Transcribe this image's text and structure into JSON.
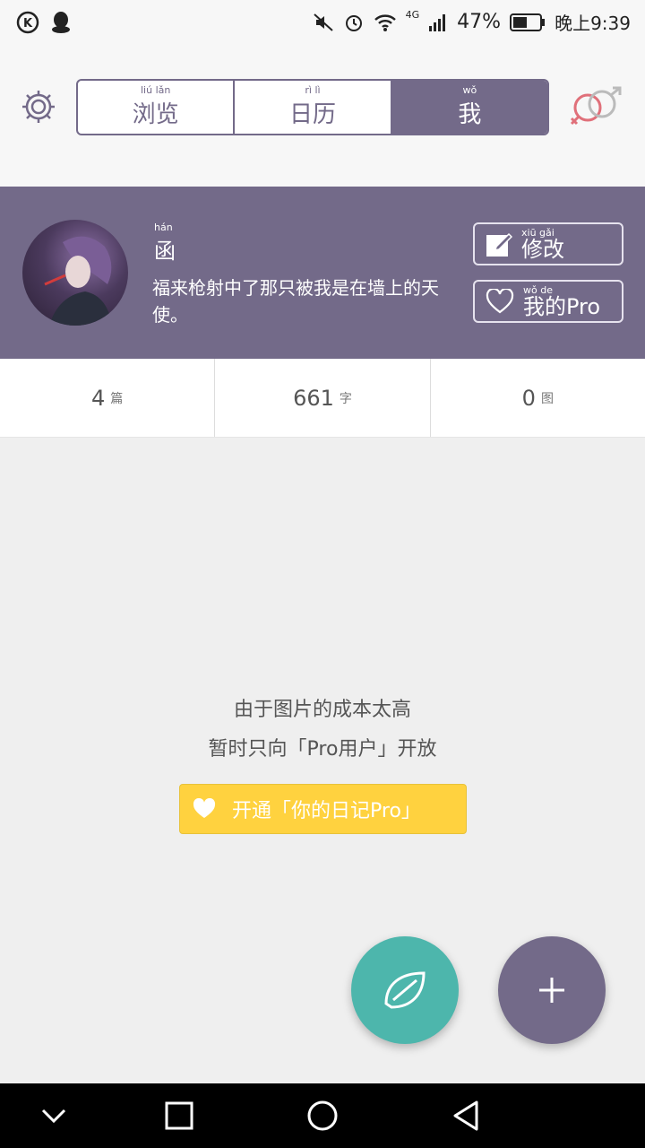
{
  "status_bar": {
    "battery": "47%",
    "network": "4G",
    "time": "晚上9:39"
  },
  "tabs": [
    {
      "label": "浏览",
      "pinyin": "liú lǎn"
    },
    {
      "label": "日历",
      "pinyin": "rì lì"
    },
    {
      "label": "我",
      "pinyin": "wǒ",
      "active": true
    }
  ],
  "profile": {
    "name": "函",
    "name_pinyin": "hán",
    "bio": "福来枪射中了那只被我是在墙上的天使。",
    "edit_label": "修改",
    "edit_pinyin": "xiū gǎi",
    "pro_label": "我的Pro",
    "pro_pinyin": "wǒ de"
  },
  "stats": [
    {
      "value": "4",
      "unit": "篇"
    },
    {
      "value": "661",
      "unit": "字"
    },
    {
      "value": "0",
      "unit": "图"
    }
  ],
  "message": {
    "line1": "由于图片的成本太高",
    "line2": "暂时只向「Pro用户」开放",
    "button_label": "开通「你的日记Pro」"
  },
  "colors": {
    "accent": "#736a89",
    "teal": "#4db6ac",
    "yellow": "#ffd23f"
  },
  "icons": [
    "settings-gear-icon",
    "gender-icon",
    "edit-icon",
    "heart-icon",
    "leaf-icon",
    "plus-icon"
  ]
}
